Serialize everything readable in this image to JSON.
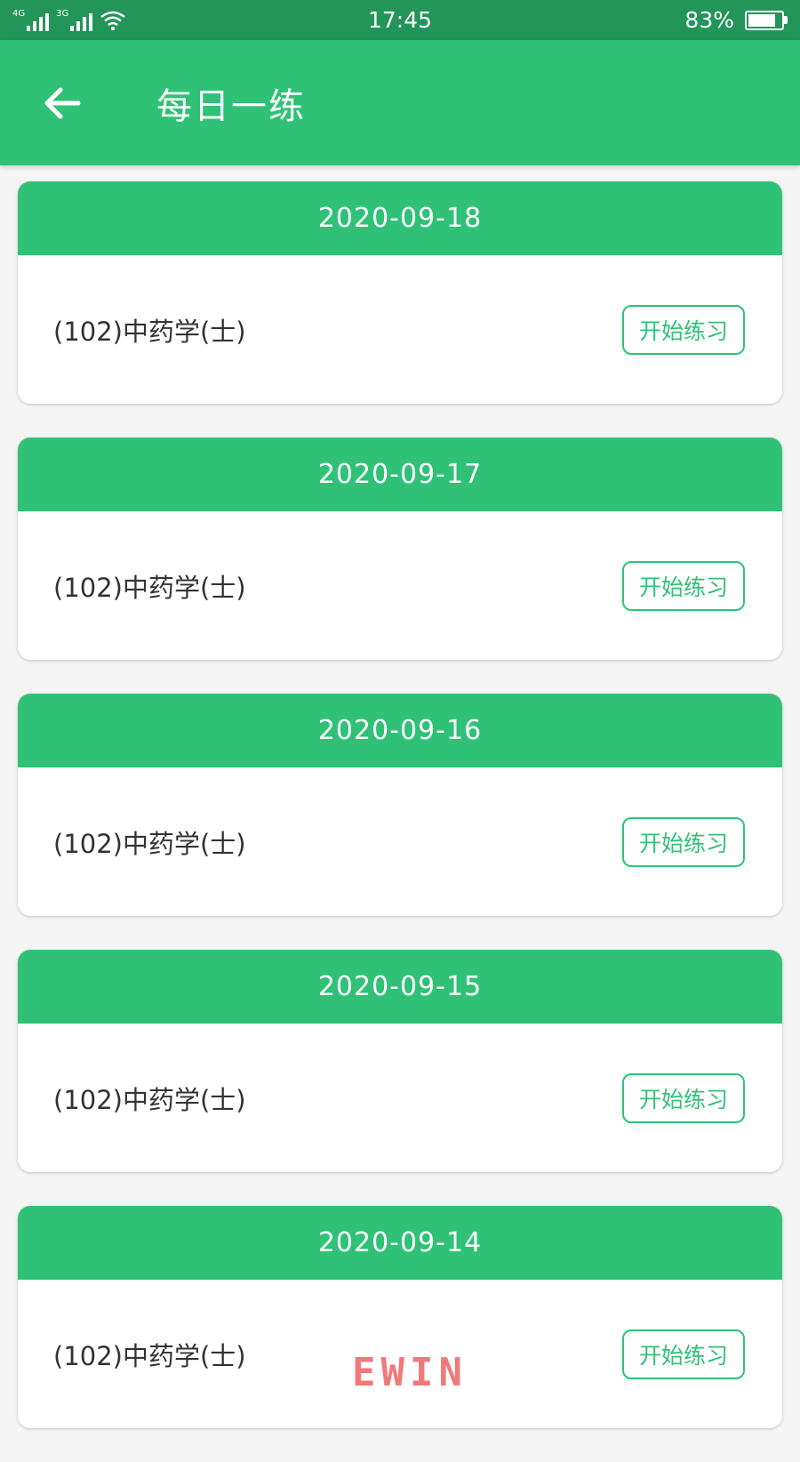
{
  "status_bar": {
    "network_1": "4G",
    "network_2": "3G",
    "time": "17:45",
    "battery_percent": "83%",
    "battery_level": 0.83
  },
  "app_bar": {
    "back_icon": "arrow-left-icon",
    "title": "每日一练"
  },
  "colors": {
    "primary": "#2fc277",
    "status_bar": "#239558",
    "background": "#f5f5f5",
    "text": "#333333"
  },
  "practice_list": [
    {
      "date": "2020-09-18",
      "subject": "(102)中药学(士)",
      "button_label": "开始练习"
    },
    {
      "date": "2020-09-17",
      "subject": "(102)中药学(士)",
      "button_label": "开始练习"
    },
    {
      "date": "2020-09-16",
      "subject": "(102)中药学(士)",
      "button_label": "开始练习"
    },
    {
      "date": "2020-09-15",
      "subject": "(102)中药学(士)",
      "button_label": "开始练习"
    },
    {
      "date": "2020-09-14",
      "subject": "(102)中药学(士)",
      "button_label": "开始练习"
    }
  ],
  "watermark": "EWIN"
}
